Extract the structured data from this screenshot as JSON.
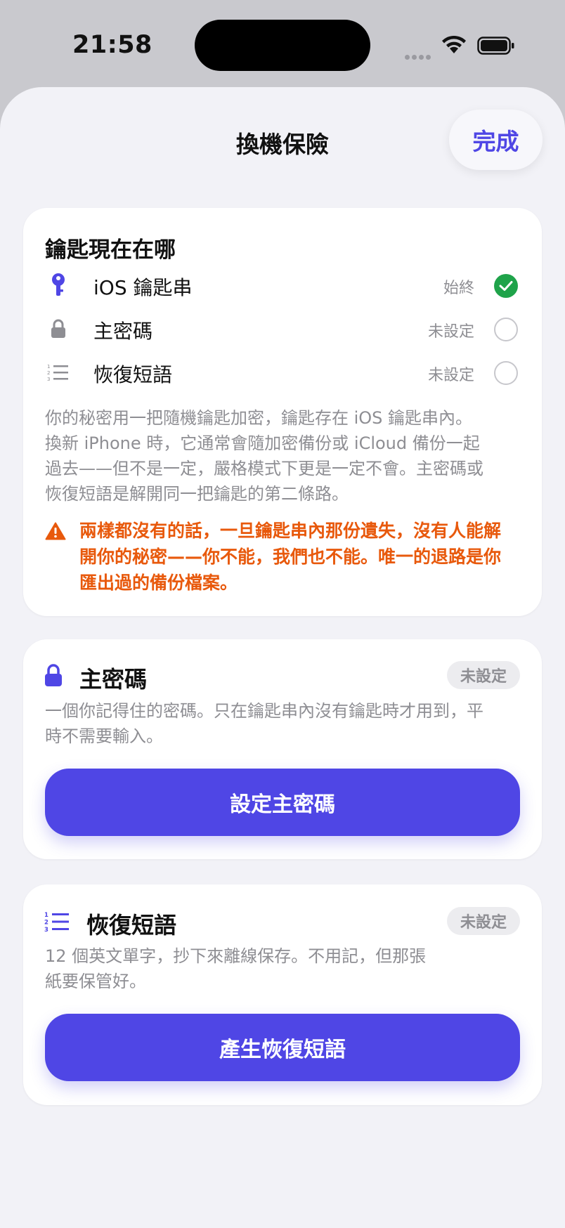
{
  "status_bar": {
    "time": "21:58"
  },
  "nav": {
    "title": "換機保險",
    "done_label": "完成"
  },
  "key_location_card": {
    "title": "鑰匙現在在哪",
    "rows": [
      {
        "label": "iOS 鑰匙串",
        "status": "始終",
        "checked": true,
        "icon": "key-icon"
      },
      {
        "label": "主密碼",
        "status": "未設定",
        "checked": false,
        "icon": "lock-icon"
      },
      {
        "label": "恢復短語",
        "status": "未設定",
        "checked": false,
        "icon": "numbered-list-icon"
      }
    ],
    "description_lines": [
      "你的秘密用一把隨機鑰匙加密，鑰匙存在 iOS 鑰匙串內。",
      "換新 iPhone 時，它通常會隨加密備份或 iCloud 備份一起",
      "過去——但不是一定，嚴格模式下更是一定不會。主密碼或",
      "恢復短語是解開同一把鑰匙的第二條路。"
    ],
    "warning_lines": [
      "兩樣都沒有的話，一旦鑰匙串內那份遺失，沒有人能解",
      "開你的秘密——你不能，我們也不能。唯一的退路是你",
      "匯出過的備份檔案。"
    ]
  },
  "master_password_card": {
    "title": "主密碼",
    "badge": "未設定",
    "description_lines": [
      "一個你記得住的密碼。只在鑰匙串內沒有鑰匙時才用到，平",
      "時不需要輸入。"
    ],
    "button_label": "設定主密碼"
  },
  "recovery_phrase_card": {
    "title": "恢復短語",
    "badge": "未設定",
    "description_lines": [
      "12 個英文單字，抄下來離線保存。不用記，但那張",
      "紙要保管好。"
    ],
    "button_label": "產生恢復短語"
  },
  "colors": {
    "accent": "#4f46e5",
    "success": "#1fa34a",
    "warning": "#e8590c"
  }
}
